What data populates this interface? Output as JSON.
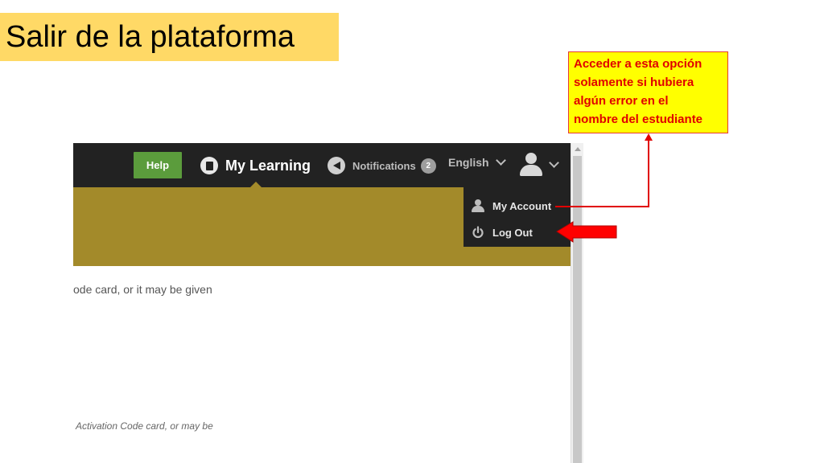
{
  "slide": {
    "title": "Salir de la plataforma",
    "callout_lines": [
      "Acceder a esta opción",
      "solamente si hubiera",
      "algún error en el",
      "nombre del estudiante"
    ]
  },
  "navbar": {
    "help_label": "Help",
    "my_learning_label": "My Learning",
    "notifications_label": "Notifications",
    "notifications_count": "2",
    "language_label": "English"
  },
  "user_menu": {
    "items": [
      {
        "label": "My Account",
        "icon": "person-icon"
      },
      {
        "label": "Log Out",
        "icon": "power-icon"
      }
    ]
  },
  "page": {
    "text_line1": "ode card, or it may be given",
    "text_line2": "Activation Code card, or may be"
  },
  "colors": {
    "title_bg": "#ffd966",
    "callout_bg": "#ffff00",
    "callout_text": "#e00000",
    "navbar_bg": "#222222",
    "help_button": "#5b9c3c",
    "banner": "#a38a2a",
    "annotation_red": "#e00000"
  }
}
